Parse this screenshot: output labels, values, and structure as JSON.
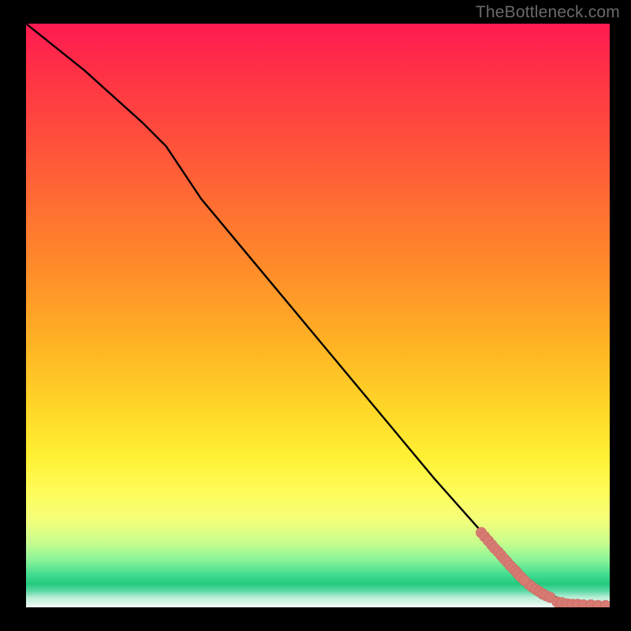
{
  "watermark": "TheBottleneck.com",
  "colors": {
    "background": "#000000",
    "curve": "#000000",
    "marker_fill": "#d67a72",
    "marker_stroke": "#c96a62",
    "gradient_stops": [
      "#ff1a52",
      "#ff3046",
      "#ff4a3e",
      "#ff6b33",
      "#ff8c2a",
      "#ffb324",
      "#ffd728",
      "#fff033",
      "#fffc58",
      "#f4ff7a",
      "#c7fd8e",
      "#86f398",
      "#3fdc8f",
      "#24c97e",
      "#5ad9a4",
      "#b9eed6",
      "#f2fbf7"
    ]
  },
  "chart_data": {
    "type": "line",
    "title": "",
    "xlabel": "",
    "ylabel": "",
    "xlim": [
      0,
      100
    ],
    "ylim": [
      0,
      100
    ],
    "grid": false,
    "series": [
      {
        "name": "curve",
        "x": [
          0,
          10,
          20,
          24,
          30,
          40,
          50,
          60,
          70,
          78,
          80,
          83,
          85,
          88,
          90,
          93,
          96,
          100
        ],
        "y": [
          100,
          92,
          83,
          79,
          70,
          58,
          46,
          34,
          22,
          13,
          10,
          7,
          5,
          3,
          2,
          1,
          0.4,
          0.3
        ]
      }
    ],
    "markers": [
      {
        "name": "cluster-upper",
        "shape": "circle",
        "r": 0.9,
        "points": [
          [
            78.0,
            12.8
          ],
          [
            78.6,
            12.1
          ],
          [
            79.2,
            11.4
          ],
          [
            79.8,
            10.7
          ],
          [
            80.3,
            10.1
          ],
          [
            80.9,
            9.5
          ],
          [
            81.4,
            8.9
          ],
          [
            81.9,
            8.3
          ],
          [
            82.4,
            7.8
          ],
          [
            82.9,
            7.2
          ],
          [
            83.4,
            6.7
          ],
          [
            83.9,
            6.2
          ],
          [
            84.3,
            5.7
          ],
          [
            84.8,
            5.2
          ]
        ]
      },
      {
        "name": "cluster-lower",
        "shape": "circle",
        "r": 0.9,
        "points": [
          [
            86.2,
            3.9
          ],
          [
            86.7,
            3.5
          ],
          [
            87.3,
            3.1
          ],
          [
            87.9,
            2.7
          ],
          [
            88.5,
            2.3
          ],
          [
            89.1,
            2.0
          ],
          [
            89.8,
            1.7
          ]
        ]
      },
      {
        "name": "tail-flat",
        "shape": "circle",
        "r": 0.9,
        "points": [
          [
            91.0,
            0.9
          ],
          [
            91.8,
            0.8
          ],
          [
            92.7,
            0.6
          ],
          [
            93.6,
            0.5
          ],
          [
            94.5,
            0.5
          ],
          [
            95.5,
            0.4
          ],
          [
            96.8,
            0.4
          ],
          [
            98.0,
            0.3
          ],
          [
            99.3,
            0.3
          ]
        ]
      },
      {
        "name": "solo-gap",
        "shape": "circle",
        "r": 0.9,
        "points": [
          [
            85.4,
            4.6
          ]
        ]
      }
    ]
  }
}
